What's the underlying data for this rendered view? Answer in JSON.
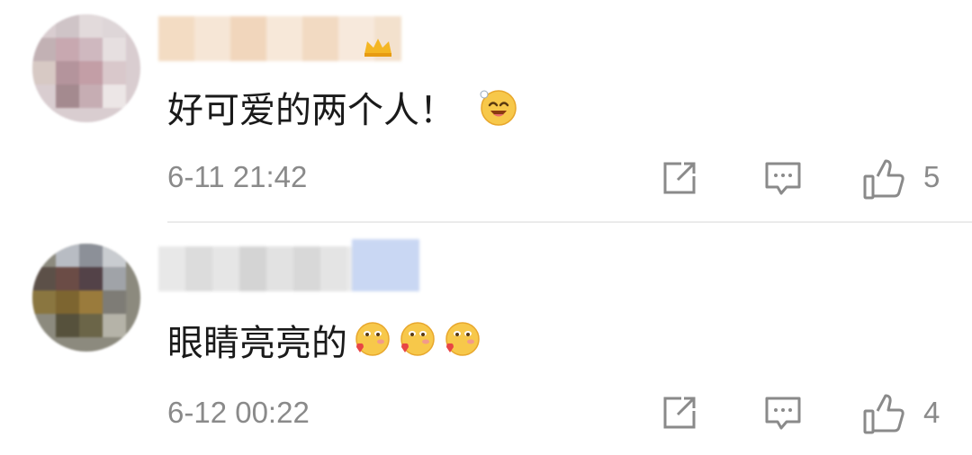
{
  "comments": [
    {
      "text": "好可爱的两个人！",
      "emojis": [
        "grin-icon"
      ],
      "time": "6-11 21:42",
      "likes": "5"
    },
    {
      "text": "眼睛亮亮的",
      "emojis": [
        "blush-heart-icon",
        "blush-heart-icon",
        "blush-heart-icon"
      ],
      "time": "6-12 00:22",
      "likes": "4"
    }
  ],
  "colors": {
    "text": "#1a1a1a",
    "meta": "#8a8a8a",
    "divider": "#ebebeb",
    "emoji": "#f7c84a"
  }
}
